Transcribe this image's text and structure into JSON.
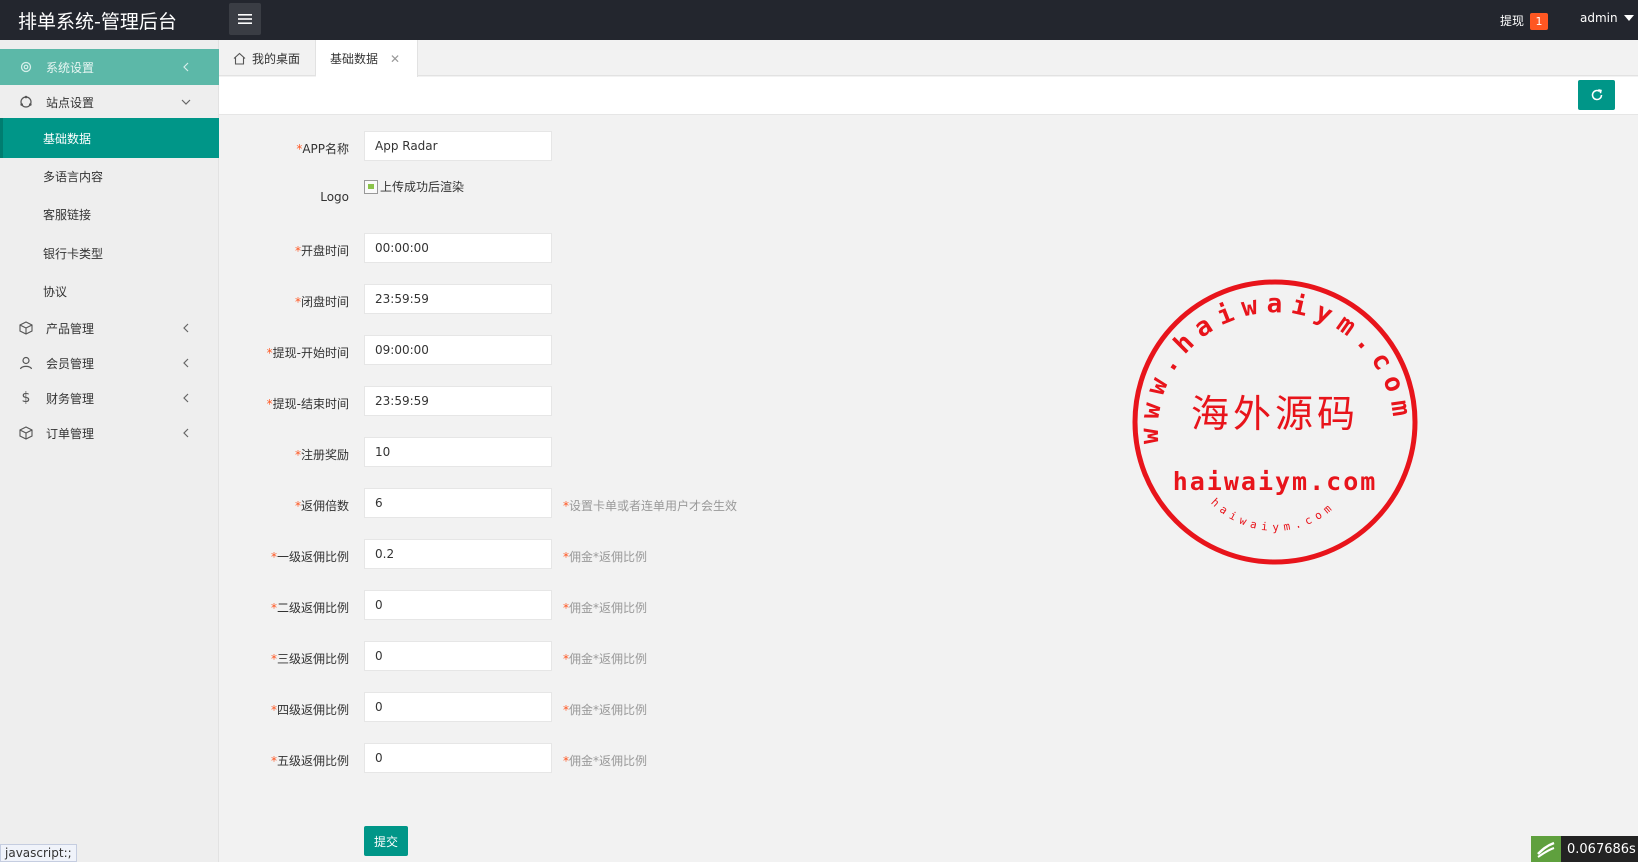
{
  "header": {
    "title": "排单系统-管理后台",
    "withdraw_label": "提现",
    "withdraw_count": "1",
    "user": "admin"
  },
  "sidebar": {
    "items": [
      {
        "label": "系统设置",
        "icon": "gear-icon"
      },
      {
        "label": "站点设置",
        "icon": "site-icon"
      },
      {
        "label": "产品管理",
        "icon": "box-icon"
      },
      {
        "label": "会员管理",
        "icon": "user-icon"
      },
      {
        "label": "财务管理",
        "icon": "dollar-icon"
      },
      {
        "label": "订单管理",
        "icon": "order-icon"
      }
    ],
    "sub_items": [
      {
        "label": "基础数据"
      },
      {
        "label": "多语言内容"
      },
      {
        "label": "客服链接"
      },
      {
        "label": "银行卡类型"
      },
      {
        "label": "协议"
      }
    ]
  },
  "tabs": [
    {
      "label": "我的桌面"
    },
    {
      "label": "基础数据"
    }
  ],
  "form": {
    "fields": [
      {
        "label": "APP名称",
        "required": true,
        "value": "App Radar",
        "hint": ""
      },
      {
        "label": "开盘时间",
        "required": true,
        "value": "00:00:00",
        "hint": ""
      },
      {
        "label": "闭盘时间",
        "required": true,
        "value": "23:59:59",
        "hint": ""
      },
      {
        "label": "提现-开始时间",
        "required": true,
        "value": "09:00:00",
        "hint": ""
      },
      {
        "label": "提现-结束时间",
        "required": true,
        "value": "23:59:59",
        "hint": ""
      },
      {
        "label": "注册奖励",
        "required": true,
        "value": "10",
        "hint": ""
      },
      {
        "label": "返佣倍数",
        "required": true,
        "value": "6",
        "hint": "设置卡单或者连单用户才会生效"
      },
      {
        "label": "一级返佣比例",
        "required": true,
        "value": "0.2",
        "hint": "佣金*返佣比例"
      },
      {
        "label": "二级返佣比例",
        "required": true,
        "value": "0",
        "hint": "佣金*返佣比例"
      },
      {
        "label": "三级返佣比例",
        "required": true,
        "value": "0",
        "hint": "佣金*返佣比例"
      },
      {
        "label": "四级返佣比例",
        "required": true,
        "value": "0",
        "hint": "佣金*返佣比例"
      },
      {
        "label": "五级返佣比例",
        "required": true,
        "value": "0",
        "hint": "佣金*返佣比例"
      }
    ],
    "logo_label": "Logo",
    "logo_alt": "上传成功后渲染",
    "submit_label": "提交",
    "required_mark": "*"
  },
  "watermark": {
    "center_text": "海外源码",
    "domain_text": "haiwaiym.com",
    "ring_text": "www.haiwaiym.com",
    "inner_ring_text": "haiwaiym.com",
    "color": "#e8141b"
  },
  "status_bar": {
    "url": "javascript:;",
    "timer": "0.067686s"
  },
  "colors": {
    "accent": "#009688",
    "header_bg": "#23262e",
    "badge": "#ff5722"
  }
}
